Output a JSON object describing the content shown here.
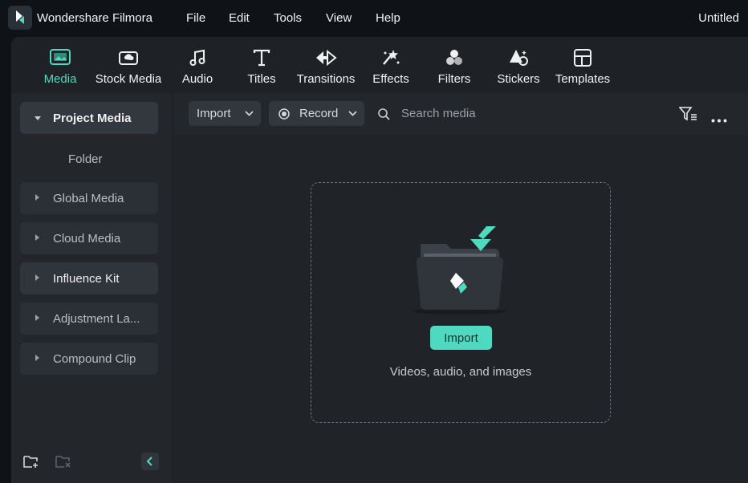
{
  "app": {
    "name": "Wondershare Filmora",
    "project_title": "Untitled"
  },
  "menu": [
    "File",
    "Edit",
    "Tools",
    "View",
    "Help"
  ],
  "toolbar": {
    "items": [
      {
        "label": "Media",
        "icon": "media-icon",
        "active": true
      },
      {
        "label": "Stock Media",
        "icon": "stock-media-icon"
      },
      {
        "label": "Audio",
        "icon": "music-note-icon"
      },
      {
        "label": "Titles",
        "icon": "text-icon"
      },
      {
        "label": "Transitions",
        "icon": "transitions-icon"
      },
      {
        "label": "Effects",
        "icon": "effects-icon"
      },
      {
        "label": "Filters",
        "icon": "filters-icon"
      },
      {
        "label": "Stickers",
        "icon": "stickers-icon"
      },
      {
        "label": "Templates",
        "icon": "templates-icon"
      }
    ]
  },
  "sidebar": {
    "items": [
      {
        "label": "Project Media",
        "expanded": true,
        "selected": true
      },
      {
        "label": "Folder"
      },
      {
        "label": "Global Media"
      },
      {
        "label": "Cloud Media"
      },
      {
        "label": "Influence Kit"
      },
      {
        "label": "Adjustment La..."
      },
      {
        "label": "Compound Clip"
      }
    ]
  },
  "content": {
    "import_dropdown": "Import",
    "record_dropdown": "Record",
    "search_placeholder": "Search media",
    "drop_zone": {
      "button": "Import",
      "hint": "Videos, audio, and images"
    }
  },
  "colors": {
    "accent": "#4fd9c0",
    "background": "#0f1216",
    "panel": "#1e2125"
  }
}
